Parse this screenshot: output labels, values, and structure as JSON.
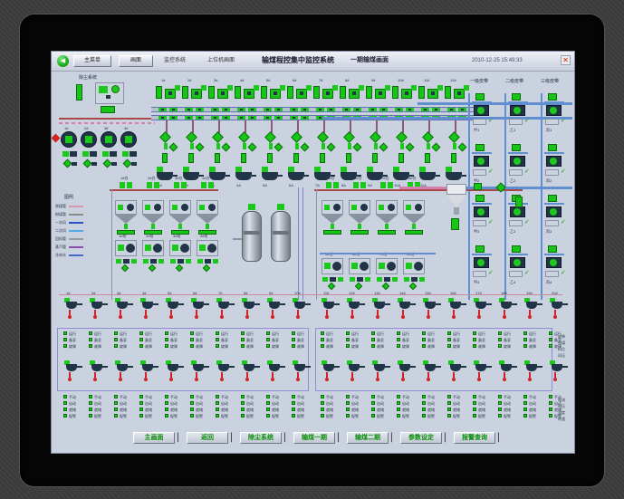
{
  "titlebar": {
    "nav_icon": "back-arrow",
    "buttons": [
      "主菜单",
      "画面"
    ],
    "crumb1": "监控系统",
    "crumb2": "上位机画面",
    "title": "输煤程控集中监控系统",
    "subtitle": "一期输煤画面",
    "datetime": "2010-12-25 15:49:33",
    "close_icon": "✕"
  },
  "top_left": {
    "label": "除尘系统",
    "pump_labels": [
      "1#",
      "2#",
      "3#",
      "4#"
    ]
  },
  "top_mid": {
    "labels": [
      "1#",
      "2#",
      "3#",
      "4#",
      "5#",
      "6#",
      "7#",
      "8#",
      "9#",
      "10#",
      "11#",
      "12#"
    ],
    "sublabels": [
      "1A",
      "2A",
      "3A",
      "4A",
      "5A",
      "6A",
      "7A",
      "8A",
      "9A",
      "10A",
      "11A",
      "12A"
    ]
  },
  "right_section": {
    "headers": [
      "一级皮带",
      "二级皮带",
      "三级皮带"
    ],
    "group_labels": [
      [
        "甲1",
        "甲2",
        "甲3",
        "甲4"
      ],
      [
        "乙1",
        "乙2",
        "乙3",
        "乙4"
      ],
      [
        "丙1",
        "丙2",
        "丙3",
        "丙4"
      ]
    ],
    "check_icon": "✓"
  },
  "legend": {
    "title": "图例",
    "rows": [
      {
        "label": "原煤管",
        "color": "#d898b0"
      },
      {
        "label": "粉煤管",
        "color": "#8a8a8a"
      },
      {
        "label": "一次风",
        "color": "#2a52c8"
      },
      {
        "label": "二次风",
        "color": "#58a8e0"
      },
      {
        "label": "回料管",
        "color": "#9a9a9a"
      },
      {
        "label": "蒸汽管",
        "color": "#8a50a8"
      },
      {
        "label": "冷却水",
        "color": "#4868c8"
      }
    ]
  },
  "hoppers": {
    "left_labels": [
      "1#仓",
      "2#仓",
      "3#仓",
      "4#仓"
    ],
    "right_labels": [
      "5#仓",
      "6#仓",
      "7#仓",
      "8#仓"
    ],
    "left_pump_labels": [
      "1#给",
      "2#给",
      "3#给",
      "4#给"
    ],
    "right_pump_labels": [
      "5#给",
      "6#给",
      "7#给",
      "8#给"
    ]
  },
  "bottom_grid": {
    "left_col_labels": [
      "1#",
      "2#",
      "3#",
      "4#",
      "5#",
      "6#",
      "7#",
      "8#",
      "9#",
      "10#"
    ],
    "right_col_labels": [
      "11#",
      "12#",
      "13#",
      "14#",
      "15#",
      "16#",
      "17#",
      "18#",
      "19#",
      "20#"
    ],
    "status_a": [
      "运行",
      "备妥",
      "故障"
    ],
    "status_b": [
      "手动",
      "自动",
      "就绪",
      "报警"
    ],
    "side_notes_top": [
      "皮带",
      "给煤",
      "料位",
      "风压"
    ],
    "side_notes_bottom": [
      "电流",
      "电压",
      "温度",
      "转速"
    ]
  },
  "toolbar": {
    "separator": "▏",
    "buttons": [
      "主画面",
      "返回",
      "除尘系统",
      "输煤一期",
      "输煤二期",
      "参数设定",
      "报警查询"
    ]
  },
  "colors": {
    "accent_green": "#17c517",
    "pipe_red": "#a84848",
    "pipe_pink": "#d87fb0",
    "pipe_blue": "#5f8fd0",
    "alarm_red": "#d42222",
    "panel_border": "#8a8fd6",
    "screen_bg": "#c9d2de"
  }
}
